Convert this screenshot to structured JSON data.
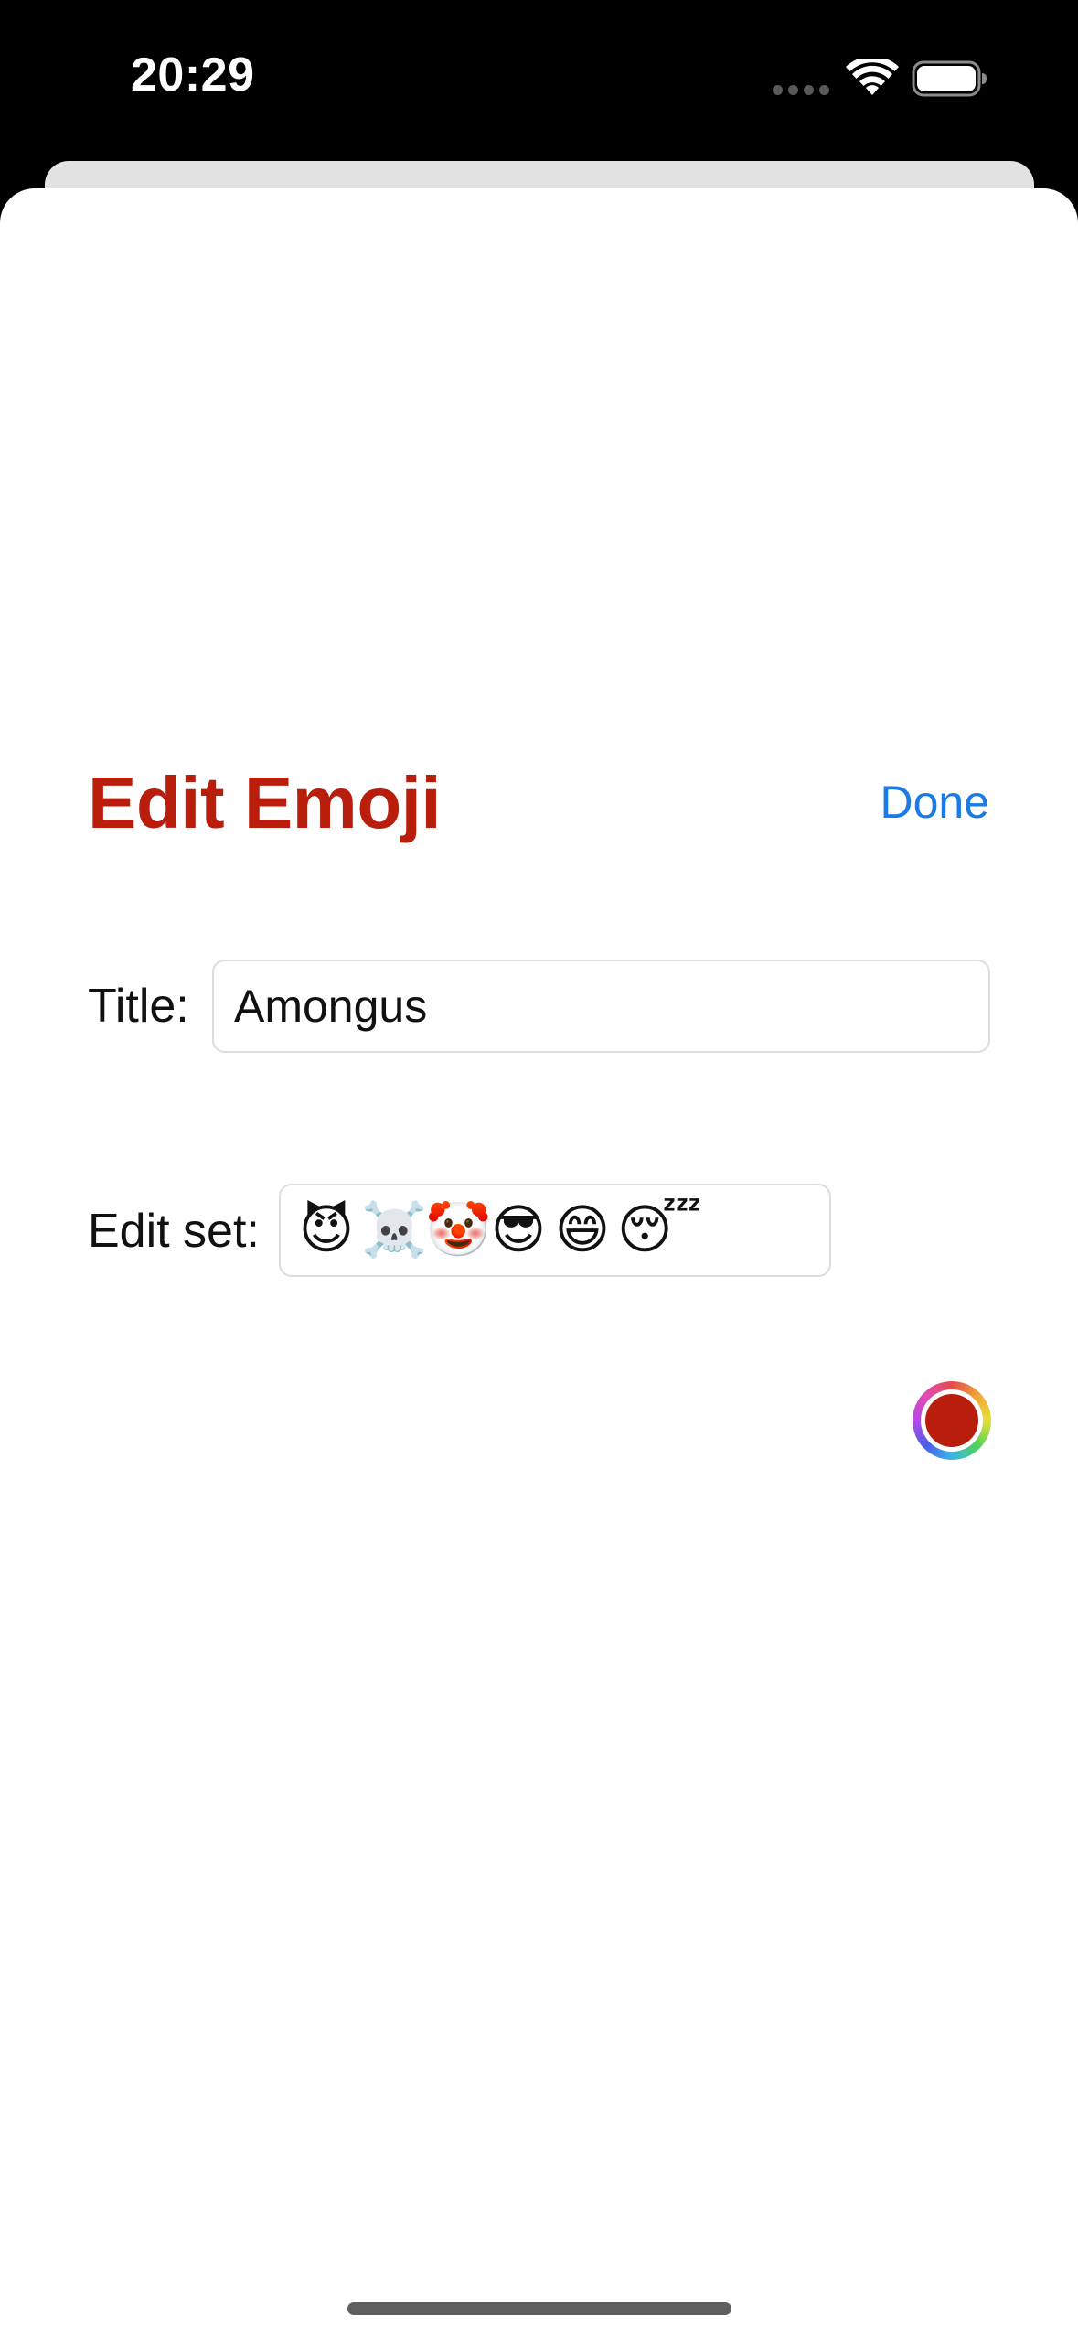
{
  "status_bar": {
    "time": "20:29",
    "icons": [
      "signal-dots-icon",
      "wifi-icon",
      "battery-icon"
    ]
  },
  "sheet": {
    "title": "Edit Emoji",
    "done_label": "Done",
    "title_row": {
      "label": "Title:",
      "value": "Amongus"
    },
    "set_row": {
      "label": "Edit set:",
      "emojis": [
        "😈",
        "☠️",
        "🤡",
        "😎",
        "😄",
        "😴"
      ]
    },
    "color_picker": {
      "selected_color": "#b91d0c"
    }
  },
  "colors": {
    "accent": "#b91d0c",
    "link": "#1a7ae6"
  }
}
